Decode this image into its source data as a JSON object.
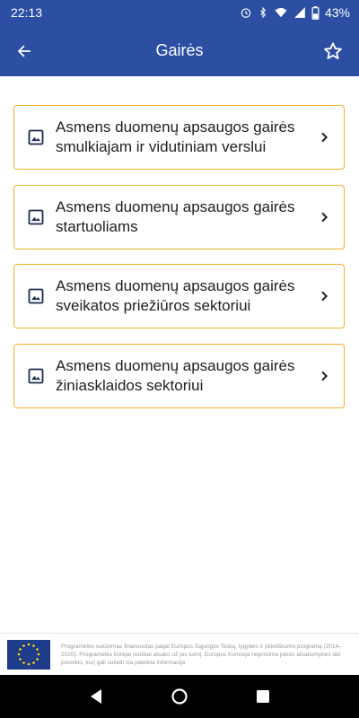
{
  "status_bar": {
    "time": "22:13",
    "battery": "43%"
  },
  "app_bar": {
    "title": "Gairės"
  },
  "items": [
    {
      "label": "Asmens duomenų apsaugos gairės smulkiajam ir vidutiniam verslui"
    },
    {
      "label": "Asmens duomenų apsaugos gairės startuoliams"
    },
    {
      "label": "Asmens duomenų apsaugos gairės sveikatos priežiūros sektoriui"
    },
    {
      "label": "Asmens duomenų apsaugos gairės žiniasklaidos sektoriui"
    }
  ],
  "footer": {
    "text": "Programėlės sukūrimas finansuotas pagal Europos Sąjungos Teisių, lygybės ir pilietiškumo programą (2014–2020). Programėlės kūrėjai visiškai atsako už jos turinį. Europos Komisija neprisiima jokios atsakomybės dėl poveikio, kurį gali sukelti čia pateikta informacija."
  },
  "colors": {
    "primary": "#2c4fa3",
    "card_border": "#f0b429",
    "icon_dark": "#1f2d50"
  },
  "icons": {
    "back": "arrow-back-icon",
    "favorite": "star-outline-icon",
    "item": "image-icon",
    "chevron": "chevron-right-icon"
  }
}
